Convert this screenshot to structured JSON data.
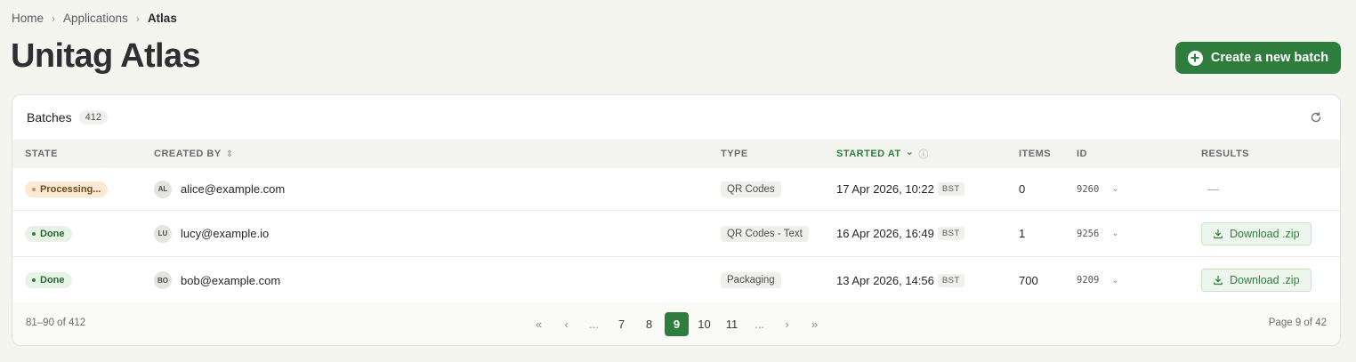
{
  "breadcrumb": {
    "home": "Home",
    "apps": "Applications",
    "current": "Atlas",
    "sep": "›"
  },
  "page_title": "Unitag Atlas",
  "create_button": {
    "label": "Create a new batch",
    "icon": "plus-circle-icon",
    "color": "#2f7d3c"
  },
  "table": {
    "title": "Batches",
    "count": "412",
    "columns": {
      "state": "STATE",
      "created_by": "CREATED BY",
      "type": "TYPE",
      "started_at": "STARTED AT",
      "items": "ITEMS",
      "id": "ID",
      "results": "RESULTS"
    },
    "sort_indicators": {
      "created_by": "⇕",
      "started_at": "⌄",
      "info": "ⓘ"
    },
    "rows": [
      {
        "state": "Processing...",
        "state_kind": "processing",
        "initials": "AL",
        "email": "alice@example.com",
        "type": "QR Codes",
        "started": "17 Apr 2026, 10:22",
        "tz": "BST",
        "items": "0",
        "id": "9260",
        "result": "—"
      },
      {
        "state": "Done",
        "state_kind": "done",
        "initials": "LU",
        "email": "lucy@example.io",
        "type": "QR Codes - Text",
        "started": "16 Apr 2026, 16:49",
        "tz": "BST",
        "items": "1",
        "id": "9256",
        "result": "Download .zip"
      },
      {
        "state": "Done",
        "state_kind": "done",
        "initials": "BO",
        "email": "bob@example.com",
        "type": "Packaging",
        "started": "13 Apr 2026, 14:56",
        "tz": "BST",
        "items": "700",
        "id": "9209",
        "result": "Download .zip"
      }
    ]
  },
  "pagination": {
    "range": "81–90 of 412",
    "page_info": "Page 9 of 42",
    "first": "«",
    "prev": "‹",
    "ellipsis": "...",
    "pages": [
      "7",
      "8",
      "9",
      "10",
      "11"
    ],
    "active": "9",
    "next": "›",
    "last": "»"
  },
  "colors": {
    "accent": "#2f7d3c",
    "background": "#f5f5f0",
    "processing": "#fbe9d3",
    "done": "#e7f3e6"
  }
}
